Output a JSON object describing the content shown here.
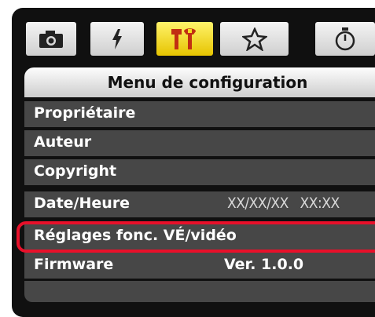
{
  "tabs": [
    {
      "icon": "camera-icon",
      "active": false
    },
    {
      "icon": "lightning-icon",
      "active": false
    },
    {
      "icon": "wrench-tools-icon",
      "active": true
    },
    {
      "icon": "star-icon",
      "active": false
    },
    {
      "icon": "stopwatch-icon",
      "active": false
    }
  ],
  "menu": {
    "title": "Menu de configuration",
    "items": [
      {
        "label": "Propriétaire",
        "value": ""
      },
      {
        "label": "Auteur",
        "value": ""
      },
      {
        "label": "Copyright",
        "value": ""
      },
      {
        "label": "Date/Heure",
        "value": "XX/XX/XX   XX:XX"
      },
      {
        "label": "Réglages fonc. VÉ/vidéo",
        "value": ""
      },
      {
        "label": "Firmware",
        "value": "Ver. 1.0.0"
      }
    ]
  },
  "highlight_color": "#e8102a",
  "active_tab_color": "#f5dc1e"
}
